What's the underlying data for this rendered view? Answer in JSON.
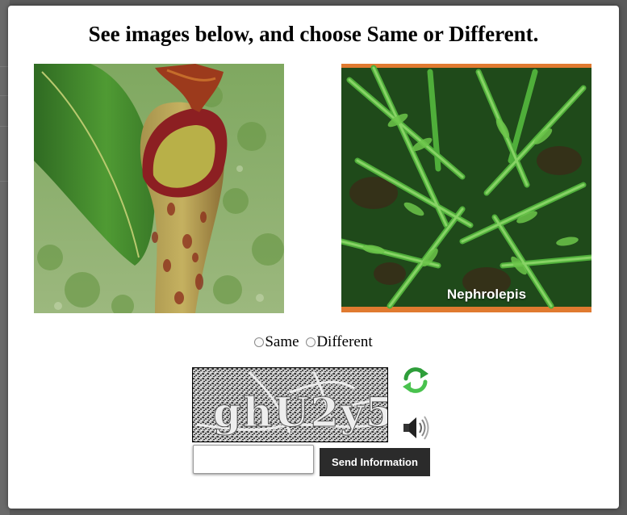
{
  "dialog": {
    "title": "See images below, and choose Same or Different."
  },
  "images": {
    "left": {
      "icon": "pitcher-plant-photo"
    },
    "right": {
      "icon": "fern-photo",
      "caption": "Nephrolepis"
    }
  },
  "choices": {
    "same_label": "Same",
    "different_label": "Different"
  },
  "captcha": {
    "text": "ghU2y5",
    "refresh_icon": "refresh-icon",
    "audio_icon": "speaker-icon"
  },
  "form": {
    "input_value": "",
    "input_placeholder": "",
    "submit_label": "Send Information"
  }
}
